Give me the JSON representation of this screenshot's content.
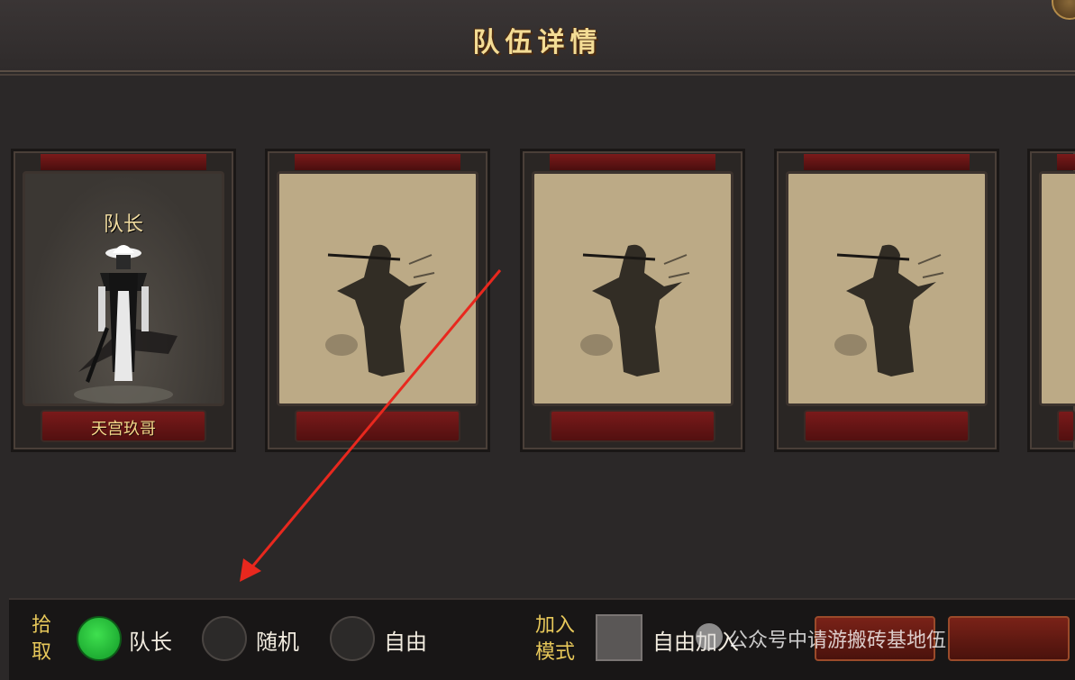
{
  "header": {
    "title": "队伍详情"
  },
  "cards": [
    {
      "role": "队长",
      "name": "天宫玖哥"
    },
    {
      "role": "",
      "name": ""
    },
    {
      "role": "",
      "name": ""
    },
    {
      "role": "",
      "name": ""
    },
    {
      "role": "",
      "name": ""
    }
  ],
  "pickup": {
    "label": "拾取",
    "options": [
      {
        "label": "队长",
        "selected": true
      },
      {
        "label": "随机",
        "selected": false
      },
      {
        "label": "自由",
        "selected": false
      }
    ]
  },
  "join_mode": {
    "label": "加入模式",
    "checkbox_label": "自由加入",
    "checked": false
  },
  "overlay": {
    "watermark": "公众号中请游搬砖基地伍"
  },
  "colors": {
    "title_gold": "#f3dc95",
    "accent_red": "#7a1a1a",
    "radio_selected": "#2fd043",
    "arrow": "#e8281e"
  }
}
